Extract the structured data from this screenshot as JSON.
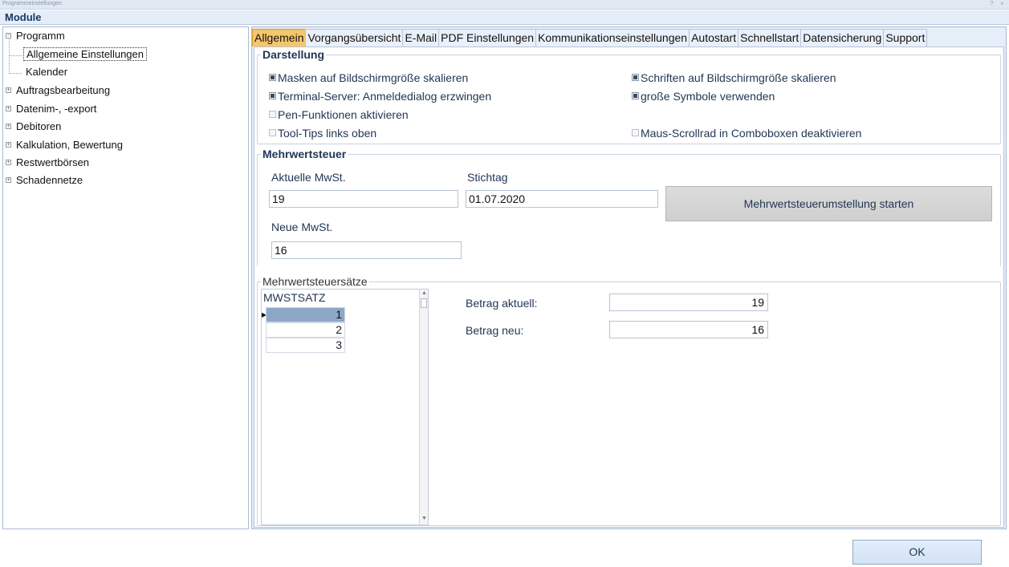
{
  "window": {
    "title": "Programmeinstellungen",
    "controls": [
      "?",
      "×"
    ]
  },
  "module_header": "Module",
  "tree": {
    "items": [
      {
        "label": "Programm",
        "expander": "⊟"
      },
      {
        "label": "Allgemeine Einstellungen"
      },
      {
        "label": "Kalender"
      },
      {
        "label": "Auftragsbearbeitung",
        "expander": "⊞"
      },
      {
        "label": "Datenim-, -export",
        "expander": "⊞"
      },
      {
        "label": "Debitoren",
        "expander": "⊞"
      },
      {
        "label": "Kalkulation, Bewertung",
        "expander": "⊞"
      },
      {
        "label": "Restwertbörsen",
        "expander": "⊞"
      },
      {
        "label": "Schadennetze",
        "expander": "⊞"
      }
    ]
  },
  "tabs": [
    "Allgemein",
    "Vorgangsübersicht",
    "E-Mail",
    "PDF Einstellungen",
    "Kommunikationseinstellungen",
    "Autostart",
    "Schnellstart",
    "Datensicherung",
    "Support"
  ],
  "darstellung": {
    "title": "Darstellung",
    "checkboxes": [
      {
        "label": "Masken auf Bildschirmgröße skalieren",
        "checked": true
      },
      {
        "label": "Schriften auf Bildschirmgröße skalieren",
        "checked": true
      },
      {
        "label": "Terminal-Server: Anmeldedialog erzwingen",
        "checked": true
      },
      {
        "label": "große Symbole verwenden",
        "checked": true
      },
      {
        "label": "Pen-Funktionen aktivieren",
        "checked": false
      },
      {
        "label": "Tool-Tips links oben",
        "checked": false
      },
      {
        "label": "Maus-Scrollrad in Comboboxen deaktivieren",
        "checked": false
      }
    ]
  },
  "mwst": {
    "title": "Mehrwertsteuer",
    "aktuelle_label": "Aktuelle MwSt.",
    "aktuelle_value": "19",
    "stichtag_label": "Stichtag",
    "stichtag_value": "01.07.2020",
    "neue_label": "Neue MwSt.",
    "neue_value": "16",
    "button": "Mehrwertsteuerumstellung starten"
  },
  "mwst_saetze": {
    "title": "Mehrwertsteuersätze",
    "column": "MWSTSATZ",
    "rows": [
      "1",
      "2",
      "3"
    ],
    "betrag_aktuell_label": "Betrag aktuell:",
    "betrag_aktuell_value": "19",
    "betrag_neu_label": "Betrag neu:",
    "betrag_neu_value": "16"
  },
  "ok_label": "OK",
  "colors": {
    "active_tab": "#f6c66c",
    "selected_row": "#8ea6c8",
    "panel_bg": "#e6eef8"
  }
}
